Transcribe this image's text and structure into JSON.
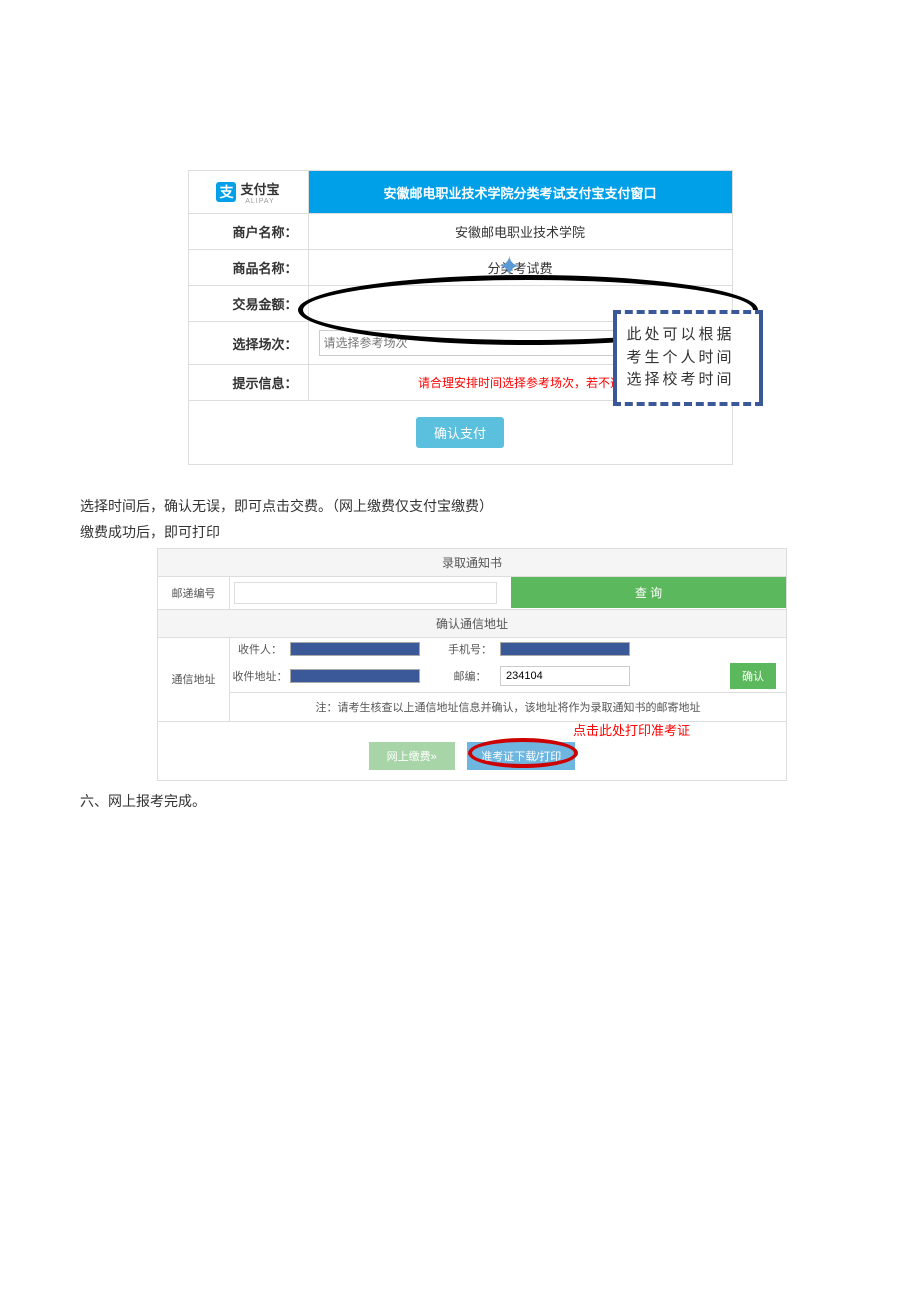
{
  "payment": {
    "alipay_brand": "支付宝",
    "alipay_sub": "ALIPAY",
    "header_title": "安徽邮电职业技术学院分类考试支付宝支付窗口",
    "merchant_label": "商户名称：",
    "merchant_value": "安徽邮电职业技术学院",
    "product_label": "商品名称：",
    "product_value": "分类考试费",
    "amount_label": "交易金额：",
    "amount_value": "",
    "session_label": "选择场次：",
    "session_placeholder": "请选择参考场次",
    "tip_label": "提示信息：",
    "tip_value": "请合理安排时间选择参考场次，若不选",
    "confirm_btn": "确认支付",
    "note_text": "此处可以根据考生个人时间选择校考时间"
  },
  "para1": "选择时间后，确认无误，即可点击交费。（网上缴费仅支付宝缴费）",
  "para2": "缴费成功后，即可打印",
  "address": {
    "admit_title": "录取通知书",
    "mail_no_label": "邮递编号",
    "query_btn": "查 询",
    "confirm_title": "确认通信地址",
    "addr_label": "通信地址",
    "recipient_label": "收件人：",
    "phone_label": "手机号：",
    "addr_sub_label": "收件地址：",
    "postcode_label": "邮编：",
    "postcode_value": "234104",
    "confirm_btn": "确认",
    "note": "注：请考生核查以上通信地址信息并确认，该地址将作为录取通知书的邮寄地址"
  },
  "buttons": {
    "pay": "网上缴费»",
    "print": "准考证下载/打印",
    "red_hint": "点击此处打印准考证"
  },
  "section6": "六、网上报考完成。"
}
